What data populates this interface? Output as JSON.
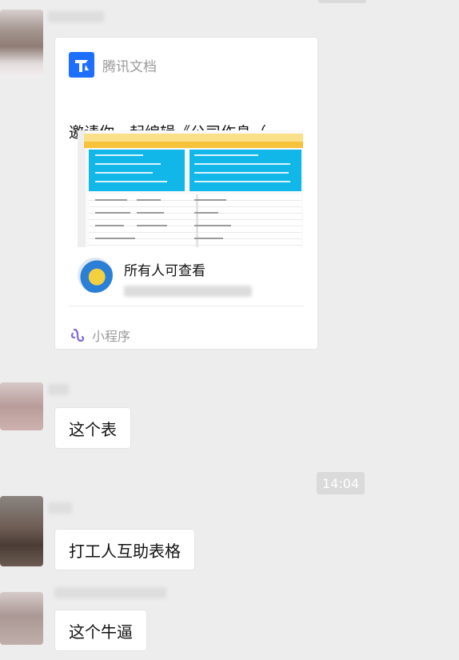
{
  "messages": {
    "card": {
      "app_name": "腾讯文档",
      "title": "邀请你一起编辑《公司作息（...",
      "share_label": "所有人可查看",
      "footer_label": "小程序"
    },
    "text1": "这个表",
    "timestamp": "14:04",
    "text2": "打工人互助表格",
    "text3": "这个牛逼"
  },
  "icons": {
    "app_logo": "tencent-docs-logo",
    "footer": "mini-program-icon"
  },
  "colors": {
    "background": "#ededed",
    "bubble": "#ffffff",
    "logo_blue": "#1e6fff",
    "mini_program_purple": "#7a6be0",
    "sheet_blue": "#12b7e9",
    "sheet_yellow": "#f6c33a"
  }
}
